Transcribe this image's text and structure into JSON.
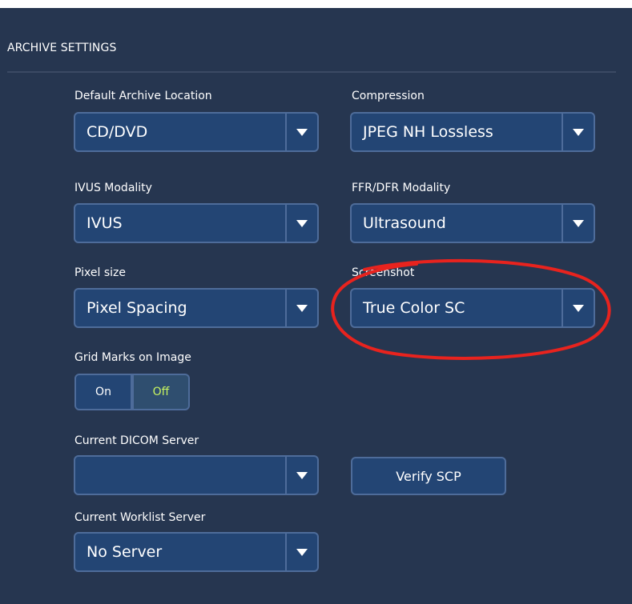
{
  "section": {
    "title": "ARCHIVE SETTINGS"
  },
  "fields": {
    "default_archive_location": {
      "label": "Default Archive Location",
      "value": "CD/DVD"
    },
    "compression": {
      "label": "Compression",
      "value": "JPEG NH Lossless"
    },
    "ivus_modality": {
      "label": "IVUS Modality",
      "value": "IVUS"
    },
    "ffr_dfr_modality": {
      "label": "FFR/DFR Modality",
      "value": "Ultrasound"
    },
    "pixel_size": {
      "label": "Pixel size",
      "value": "Pixel Spacing"
    },
    "screenshot": {
      "label": "Screenshot",
      "value": "True Color SC"
    },
    "current_dicom_server": {
      "label": "Current DICOM Server",
      "value": ""
    },
    "current_worklist_server": {
      "label": "Current Worklist Server",
      "value": "No Server"
    }
  },
  "grid_marks": {
    "label": "Grid Marks on Image",
    "on_label": "On",
    "off_label": "Off",
    "selected": "Off"
  },
  "verify_button": {
    "label": "Verify SCP"
  },
  "colors": {
    "panel_background": "#263650",
    "control_fill": "#234574",
    "control_border": "#4e6c9a",
    "selected_toggle_text": "#c8f560",
    "annotation_circle": "#e8231e"
  },
  "icons": {
    "dropdown_arrow": "triangle-down-icon"
  }
}
